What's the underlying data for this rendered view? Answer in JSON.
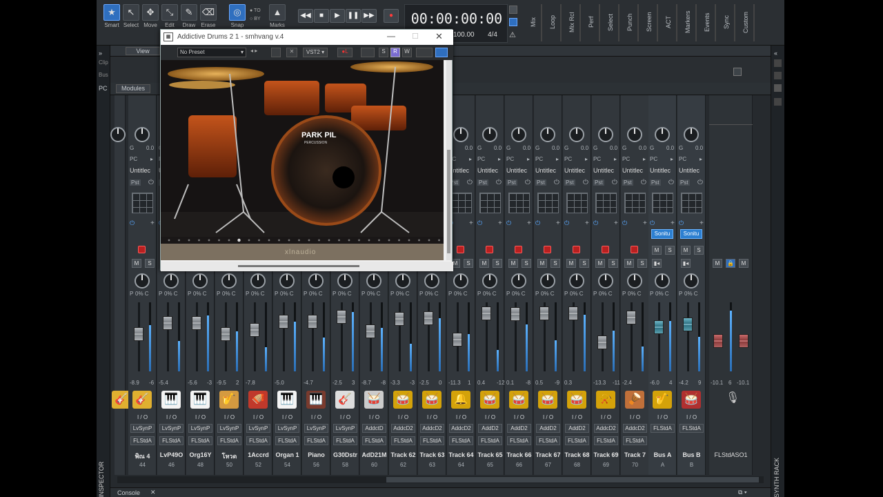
{
  "toolbar": {
    "tools": [
      {
        "label": "Smart",
        "icon": "star-icon",
        "active": true
      },
      {
        "label": "Select",
        "icon": "cursor-icon"
      },
      {
        "label": "Move",
        "icon": "move-icon"
      },
      {
        "label": "Edit",
        "icon": "edit-icon"
      },
      {
        "label": "Draw",
        "icon": "pencil-icon"
      },
      {
        "label": "Erase",
        "icon": "eraser-icon"
      }
    ],
    "snap_label": "Snap",
    "to_label": "TO",
    "by_label": "BY",
    "marks_label": "Marks",
    "transport": [
      "rewind",
      "stop",
      "play",
      "pause",
      "fast-forward",
      "record"
    ],
    "timecode": "00:00:00:00",
    "tempo": "100.00",
    "meter": "4/4",
    "module_labels": [
      "Mix",
      "Loop",
      "Mix Rcl",
      "Perf",
      "Select",
      "Punch",
      "Screen",
      "ACT",
      "Markers",
      "Events",
      "Sync",
      "Custom"
    ]
  },
  "side": {
    "clip": "Clip",
    "bus": "Bus",
    "pc": "PC",
    "view_menu": "View",
    "modules_menu": "Modules",
    "inspector": "INSPECTOR",
    "synth_rack": "SYNTH RACK"
  },
  "plugin": {
    "title": "Addictive Drums 2 1 - smhvang v.4",
    "preset": "No Preset",
    "format": "VST2",
    "buttons": [
      "S",
      "R",
      "W"
    ],
    "kit_brand": "PARK PIL",
    "kit_sub": "PERCUSSION",
    "footer": "xlnaudio"
  },
  "channels": [
    {
      "name": "",
      "num": "",
      "pre": "",
      "post": "",
      "vol": "",
      "pan": "0% C",
      "inst": "guitar",
      "color": "#e0b030"
    },
    {
      "name": "พิณ 4",
      "num": "44",
      "pre": "LvSynP",
      "post": "FLStdA",
      "vol": "-8.9",
      "peak": "-6",
      "pan": "0% C",
      "inst": "guitar",
      "color": "#e0b030",
      "fader": 0.55
    },
    {
      "name": "LvP49O",
      "num": "46",
      "pre": "LvSynP",
      "post": "FLStdA",
      "vol": "-5.4",
      "peak": "",
      "pan": "0% C",
      "inst": "piano",
      "color": "#f4f4f4",
      "fader": 0.75
    },
    {
      "name": "Org16Y",
      "num": "48",
      "pre": "LvSynP",
      "post": "FLStdA",
      "vol": "-5.6",
      "peak": "-3",
      "pan": "0% C",
      "inst": "piano",
      "color": "#f4f4f4",
      "fader": 0.75
    },
    {
      "name": "โหวด",
      "num": "50",
      "pre": "LvSynP",
      "post": "FLStdA",
      "vol": "-9.5",
      "peak": "2",
      "pan": "0% C",
      "inst": "flute",
      "color": "#d49a40",
      "fader": 0.55
    },
    {
      "name": "1Accrd",
      "num": "52",
      "pre": "LvSynP",
      "post": "FLStdA",
      "vol": "-7.8",
      "peak": "",
      "pan": "0% C",
      "inst": "accordion",
      "color": "#c0392b",
      "fader": 0.62
    },
    {
      "name": "Organ 1",
      "num": "54",
      "pre": "LvSynP",
      "post": "FLStdA",
      "vol": "-5.0",
      "peak": "",
      "pan": "0% C",
      "inst": "piano",
      "color": "#f4f4f4",
      "fader": 0.77
    },
    {
      "name": "Piano",
      "num": "56",
      "pre": "LvSynP",
      "post": "FLStdA",
      "vol": "-4.7",
      "peak": "",
      "pan": "0% C",
      "inst": "grand",
      "color": "#7a3b2e",
      "fader": 0.78
    },
    {
      "name": "G30Dstr",
      "num": "58",
      "pre": "LvSynP",
      "post": "FLStdA",
      "vol": "-2.5",
      "peak": "3",
      "pan": "0% C",
      "inst": "guitar2",
      "color": "#dddddd",
      "fader": 0.86
    },
    {
      "name": "AdD21M",
      "num": "60",
      "pre": "AddctD",
      "post": "FLStdA",
      "vol": "-8.7",
      "peak": "-8",
      "pan": "0% C",
      "inst": "drumkit",
      "color": "#cccccc",
      "fader": 0.6
    },
    {
      "name": "Track 62",
      "num": "62",
      "pre": "AddcD2",
      "post": "FLStdA",
      "vol": "-3.3",
      "peak": "-3",
      "pan": "0% C",
      "inst": "drum",
      "color": "#d4a20a",
      "fader": 0.82
    },
    {
      "name": "Track 63",
      "num": "63",
      "pre": "AddcD2",
      "post": "FLStdA",
      "vol": "-2.5",
      "peak": "0",
      "pan": "0% C",
      "inst": "snare",
      "color": "#d4a20a",
      "fader": 0.84
    },
    {
      "name": "Track 64",
      "num": "64",
      "pre": "AddcD2",
      "post": "FLStdA",
      "vol": "-11.3",
      "peak": "1",
      "pan": "0% C",
      "inst": "cymbal",
      "color": "#d4a20a",
      "fader": 0.45
    },
    {
      "name": "Track 65",
      "num": "65",
      "pre": "AddD2",
      "post": "FLStdA",
      "vol": "0.4",
      "peak": "-12",
      "pan": "0% C",
      "inst": "tom",
      "color": "#d4a20a",
      "fader": 0.92
    },
    {
      "name": "Track 66",
      "num": "66",
      "pre": "AddD2",
      "post": "FLStdA",
      "vol": "0.1",
      "peak": "-8",
      "pan": "0% C",
      "inst": "tom",
      "color": "#d4a20a",
      "fader": 0.91
    },
    {
      "name": "Track 67",
      "num": "67",
      "pre": "AddD2",
      "post": "FLStdA",
      "vol": "0.5",
      "peak": "-9",
      "pan": "0% C",
      "inst": "tom",
      "color": "#d4a20a",
      "fader": 0.92
    },
    {
      "name": "Track 68",
      "num": "68",
      "pre": "AddD2",
      "post": "FLStdA",
      "vol": "0.3",
      "peak": "",
      "pan": "0% C",
      "inst": "tom",
      "color": "#d4a20a",
      "fader": 0.92
    },
    {
      "name": "Track 69",
      "num": "69",
      "pre": "AddcD2",
      "post": "FLStdA",
      "vol": "-13.3",
      "peak": "-11",
      "pan": "0% C",
      "inst": "horn",
      "color": "#d4a20a",
      "fader": 0.4
    },
    {
      "name": "Track 7",
      "num": "70",
      "pre": "AddcD2",
      "post": "FLStdA",
      "vol": "-2.4",
      "peak": "",
      "pan": "0% C",
      "inst": "percussion",
      "color": "#c0703a",
      "fader": 0.85
    },
    {
      "name": "Bus A",
      "num": "A",
      "pre": "",
      "post": "FLStdA",
      "vol": "-6.0",
      "peak": "4",
      "pan": "0% C",
      "inst": "sax",
      "color": "#d4a20a",
      "fader": 0.68,
      "bus": true
    },
    {
      "name": "Bus B",
      "num": "B",
      "pre": "",
      "post": "FLStdA",
      "vol": "-4.2",
      "peak": "9",
      "pan": "0% C",
      "inst": "drumkit2",
      "color": "#b03030",
      "fader": 0.73,
      "bus": true
    }
  ],
  "master": {
    "name": "FLStdASO1",
    "vol_l": "-10.1",
    "vol_m": "6",
    "vol_r": "-10.1"
  },
  "common": {
    "io": "I / O",
    "pc": "PC",
    "untitled": "Untitlec",
    "pst": "Pst",
    "sonitu": "Sonitu",
    "g": "G",
    "zero": "0.0",
    "p": "P",
    "m": "M",
    "s": "S",
    "r": "R"
  },
  "bottom": {
    "console_tab": "Console"
  }
}
